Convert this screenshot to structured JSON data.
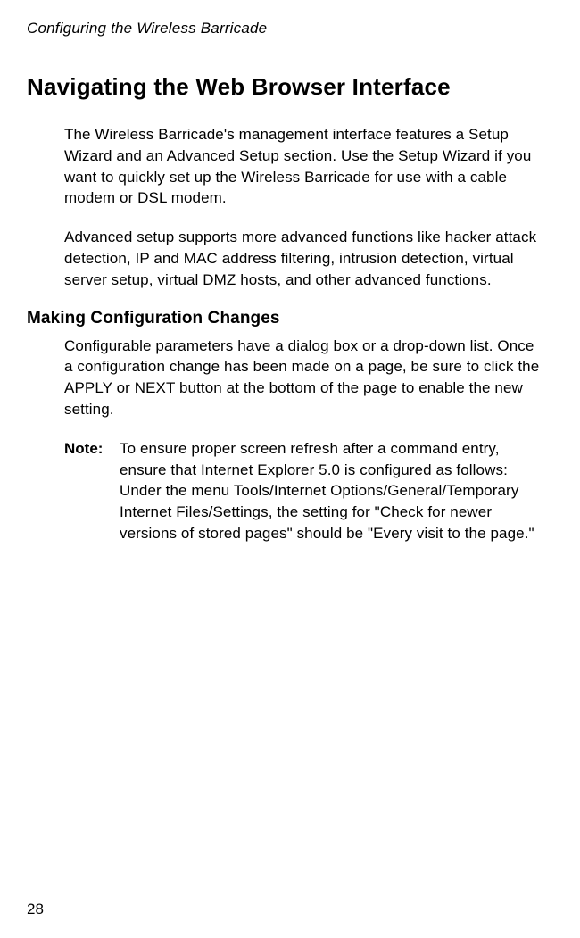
{
  "header": {
    "running": "Configuring the Wireless Barricade"
  },
  "section": {
    "title": "Navigating the Web Browser Interface",
    "para1": "The Wireless Barricade's management interface features a Setup Wizard and an Advanced Setup section. Use the Setup Wizard if you want to quickly set up the Wireless Barricade for use with a cable modem or DSL modem.",
    "para2": "Advanced setup supports more advanced functions like hacker attack detection, IP and MAC address filtering, intrusion detection, virtual server setup, virtual DMZ hosts, and other advanced functions."
  },
  "subsection": {
    "title": "Making Configuration Changes",
    "para1": "Configurable parameters have a dialog box or a drop-down list. Once a configuration change has been made on a page, be sure to click the APPLY or NEXT button at the bottom of the page to enable the new setting.",
    "note_label": "Note:",
    "note_body": "To ensure proper screen refresh after a command entry, ensure that Internet Explorer 5.0 is configured as follows: Under the menu Tools/Internet Options/General/Temporary Internet Files/Settings, the setting for \"Check for newer versions of stored pages\" should be \"Every visit to the page.\""
  },
  "footer": {
    "page_number": "28"
  }
}
